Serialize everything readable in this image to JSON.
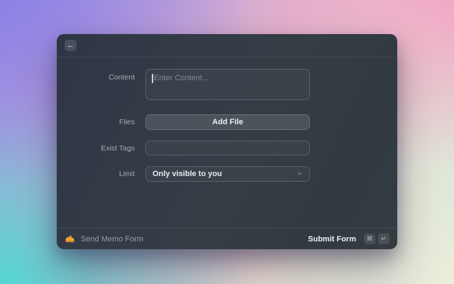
{
  "header": {
    "back_icon": "←"
  },
  "form": {
    "content": {
      "label": "Content",
      "placeholder": "Enter Content...",
      "value": ""
    },
    "files": {
      "label": "Files",
      "button_label": "Add File"
    },
    "exist_tags": {
      "label": "Exist Tags",
      "value": "",
      "placeholder": ""
    },
    "limit": {
      "label": "Limit",
      "value": "Only visible to you",
      "chevron_icon": "⌄"
    }
  },
  "footer": {
    "app_name": "Send Memo Form",
    "submit_label": "Submit Form",
    "keys": [
      "⌘",
      "↵"
    ]
  },
  "colors": {
    "app_icon_yellow": "#f0a32f",
    "app_icon_yellow_dark": "#d78a25",
    "panel_base": "#323b43",
    "bg_top_left": "#8a7ee6",
    "bg_top_right": "#f2a1c4",
    "bg_bottom_left": "#3fdcd1",
    "bg_bottom_right": "#f5eedc"
  }
}
